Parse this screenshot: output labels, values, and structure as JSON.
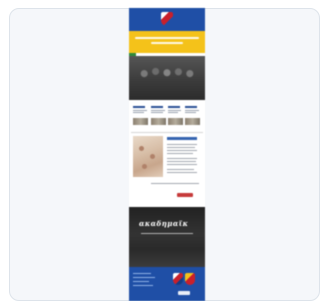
{
  "thumbnail": {
    "dark_section": {
      "script_text": "ακαδημαϊκ"
    }
  },
  "colors": {
    "header_blue": "#1f4fa6",
    "banner_yellow": "#f4c21a",
    "accent_red": "#c63a3a",
    "card_border": "#dde3ea"
  }
}
